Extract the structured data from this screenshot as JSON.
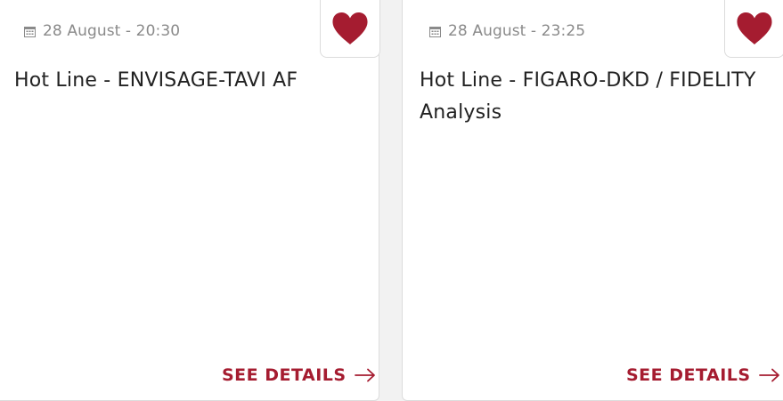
{
  "cards": [
    {
      "date": "28 August - 20:30",
      "title": "Hot Line - ENVISAGE-TAVI AF",
      "cta": "SEE DETAILS"
    },
    {
      "date": "28 August - 23:25",
      "title": "Hot Line - FIGARO-DKD / FIDELITY Analysis",
      "cta": "SEE DETAILS"
    }
  ],
  "colors": {
    "accent": "#a51c30",
    "meta_text": "#8a8a8a",
    "title_text": "#222222",
    "card_border": "#dcdcdc",
    "background": "#f2f2f2"
  },
  "icons": {
    "calendar": "calendar-icon",
    "favorite": "heart-icon",
    "cta_arrow": "arrow-right-icon"
  }
}
